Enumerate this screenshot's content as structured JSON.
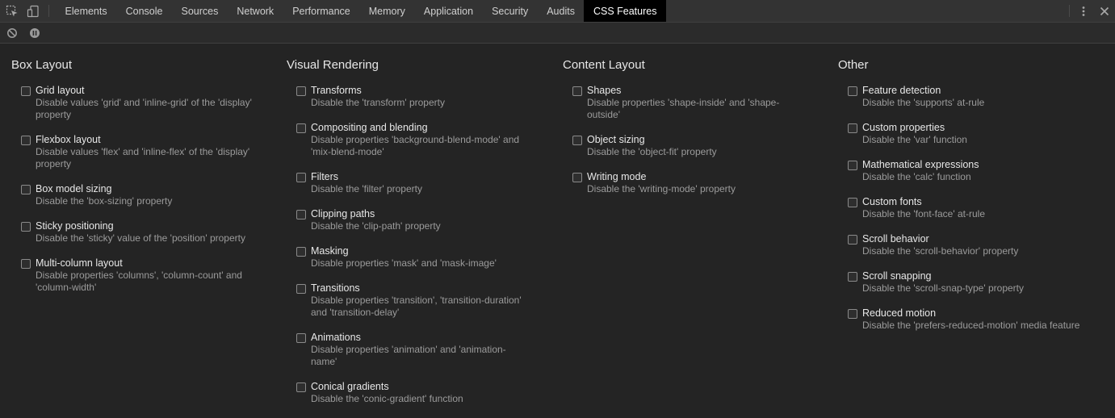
{
  "tabbar": {
    "tabs": [
      {
        "label": "Elements"
      },
      {
        "label": "Console"
      },
      {
        "label": "Sources"
      },
      {
        "label": "Network"
      },
      {
        "label": "Performance"
      },
      {
        "label": "Memory"
      },
      {
        "label": "Application"
      },
      {
        "label": "Security"
      },
      {
        "label": "Audits"
      },
      {
        "label": "CSS Features"
      }
    ],
    "active_tab": "CSS Features"
  },
  "icons": {
    "inspect": "inspect-element-icon",
    "device": "device-toolbar-icon",
    "more": "kebab-menu-icon",
    "close": "close-icon",
    "clear": "clear-icon",
    "pause": "pause-icon"
  },
  "columns": [
    {
      "title": "Box Layout",
      "options": [
        {
          "label": "Grid layout",
          "desc": "Disable values 'grid' and 'inline-grid' of the 'display' property"
        },
        {
          "label": "Flexbox layout",
          "desc": "Disable values 'flex' and 'inline-flex' of the 'display' property"
        },
        {
          "label": "Box model sizing",
          "desc": "Disable the 'box-sizing' property"
        },
        {
          "label": "Sticky positioning",
          "desc": "Disable the 'sticky' value of the 'position' property"
        },
        {
          "label": "Multi-column layout",
          "desc": "Disable properties 'columns', 'column-count' and 'column-width'"
        }
      ]
    },
    {
      "title": "Visual Rendering",
      "options": [
        {
          "label": "Transforms",
          "desc": "Disable the 'transform' property"
        },
        {
          "label": "Compositing and blending",
          "desc": "Disable properties 'background-blend-mode' and 'mix-blend-mode'"
        },
        {
          "label": "Filters",
          "desc": "Disable the 'filter' property"
        },
        {
          "label": "Clipping paths",
          "desc": "Disable the 'clip-path' property"
        },
        {
          "label": "Masking",
          "desc": "Disable properties 'mask' and 'mask-image'"
        },
        {
          "label": "Transitions",
          "desc": "Disable properties 'transition', 'transition-duration' and 'transition-delay'"
        },
        {
          "label": "Animations",
          "desc": "Disable properties 'animation' and 'animation-name'"
        },
        {
          "label": "Conical gradients",
          "desc": "Disable the 'conic-gradient' function"
        }
      ]
    },
    {
      "title": "Content Layout",
      "options": [
        {
          "label": "Shapes",
          "desc": "Disable properties 'shape-inside' and 'shape-outside'"
        },
        {
          "label": "Object sizing",
          "desc": "Disable the 'object-fit' property"
        },
        {
          "label": "Writing mode",
          "desc": "Disable the 'writing-mode' property"
        }
      ]
    },
    {
      "title": "Other",
      "options": [
        {
          "label": "Feature detection",
          "desc": "Disable the 'supports' at-rule"
        },
        {
          "label": "Custom properties",
          "desc": "Disable the 'var' function"
        },
        {
          "label": "Mathematical expressions",
          "desc": "Disable the 'calc' function"
        },
        {
          "label": "Custom fonts",
          "desc": "Disable the 'font-face' at-rule"
        },
        {
          "label": "Scroll behavior",
          "desc": "Disable the 'scroll-behavior' property"
        },
        {
          "label": "Scroll snapping",
          "desc": "Disable the 'scroll-snap-type' property"
        },
        {
          "label": "Reduced motion",
          "desc": "Disable the 'prefers-reduced-motion' media feature"
        }
      ]
    }
  ]
}
